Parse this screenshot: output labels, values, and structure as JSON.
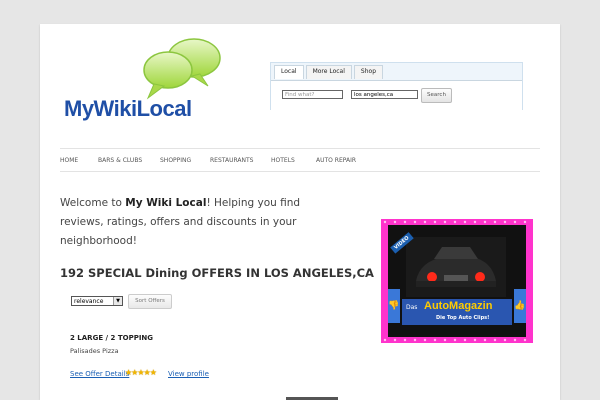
{
  "logo": {
    "text": "MyWikiLocal"
  },
  "search": {
    "tabs": [
      "Local",
      "More Local",
      "Shop"
    ],
    "what_placeholder": "Find what?",
    "where_value": "los angeles,ca",
    "button_label": "Search"
  },
  "nav": {
    "items": [
      "HOME",
      "BARS & CLUBS",
      "SHOPPING",
      "RESTAURANTS",
      "HOTELS",
      "AUTO REPAIR"
    ]
  },
  "welcome": {
    "prefix": "Welcome to ",
    "brand": "My Wiki Local",
    "suffix": "!  Helping you find reviews, ratings, offers and discounts in your neighborhood!"
  },
  "offers": {
    "title": "192 SPECIAL Dining OFFERS IN LOS ANGELES,CA",
    "sort_value": "relevance",
    "sort_button": "Sort Offers"
  },
  "listing": {
    "title": "2 LARGE / 2 TOPPING",
    "business": "Palisades Pizza",
    "see_offer": "See Offer Details",
    "stars": "★★★★★",
    "view_profile": "View profile"
  },
  "ad": {
    "badge": "VIDEO",
    "das": "Das",
    "auto": "AutoMagazin",
    "sub": "Die Top Auto Clips!"
  },
  "colors": {
    "brand_blue": "#1f4fa6",
    "link": "#1a5fb4",
    "ad_border": "#ff33cc",
    "star": "#f2b600"
  }
}
